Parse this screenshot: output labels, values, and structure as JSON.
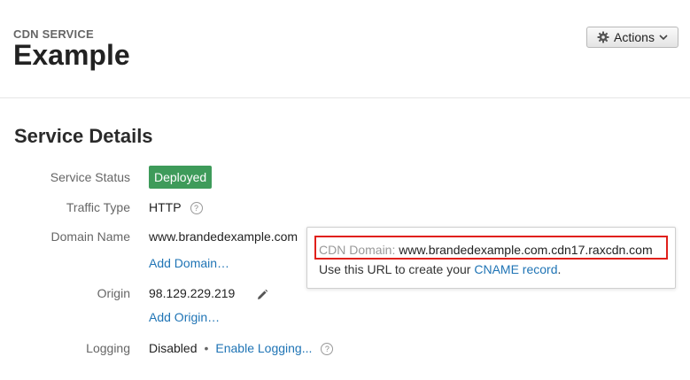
{
  "header": {
    "eyebrow": "CDN SERVICE",
    "title": "Example",
    "actions_label": "Actions",
    "actions_icon": "gear-icon",
    "caret_icon": "chevron-down-icon"
  },
  "details": {
    "title": "Service Details",
    "status_label": "Service Status",
    "status_value": "Deployed",
    "status_color": "#3e9b5a",
    "traffic_label": "Traffic Type",
    "traffic_value": "HTTP",
    "domain_label": "Domain Name",
    "domain_value": "www.brandedexample.com",
    "add_domain": "Add Domain…",
    "origin_label": "Origin",
    "origin_value": "98.129.229.219",
    "add_origin": "Add Origin…",
    "logging_label": "Logging",
    "logging_value": "Disabled",
    "enable_logging": "Enable Logging...",
    "help_glyph": "?"
  },
  "tooltip": {
    "domain_key": "CDN Domain:",
    "domain_value": "www.brandedexample.com.cdn17.raxcdn.com",
    "hint_prefix": "Use this URL to create your",
    "hint_link": "CNAME record",
    "hint_suffix": ".",
    "highlight_color": "#e0201b"
  },
  "colors": {
    "link": "#1f74b5",
    "label": "#666666"
  }
}
